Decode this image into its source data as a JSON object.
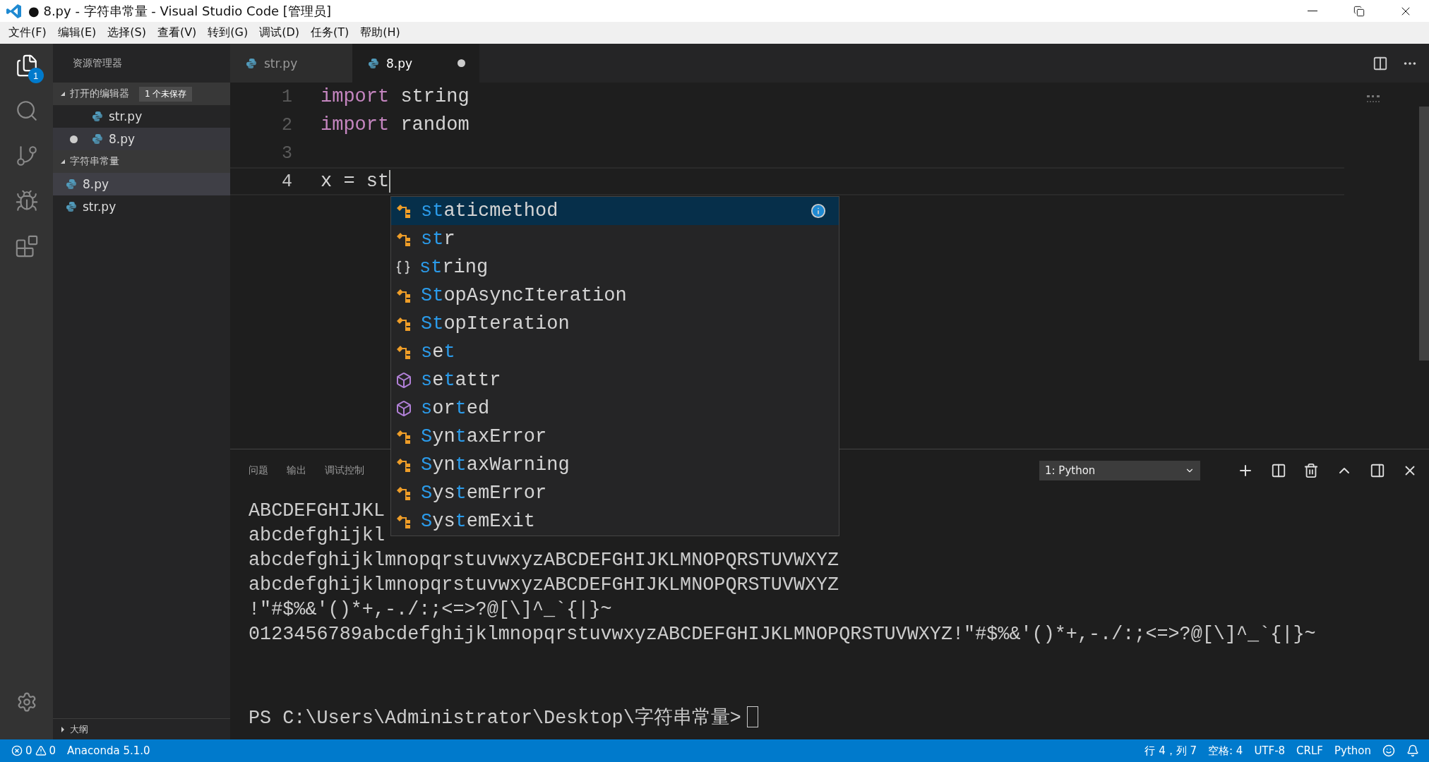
{
  "window": {
    "title": "● 8.py - 字符串常量 - Visual Studio Code [管理员]"
  },
  "menu": [
    "文件(F)",
    "编辑(E)",
    "选择(S)",
    "查看(V)",
    "转到(G)",
    "调试(D)",
    "任务(T)",
    "帮助(H)"
  ],
  "activity_bar": [
    {
      "kind": "explorer",
      "selected": true,
      "badge": "1"
    },
    {
      "kind": "search",
      "selected": false
    },
    {
      "kind": "source-control",
      "selected": false
    },
    {
      "kind": "debug",
      "selected": false
    },
    {
      "kind": "extensions",
      "selected": false
    }
  ],
  "sidebar": {
    "title": "资源管理器",
    "sections": [
      {
        "kind": "open-editors",
        "title": "打开的编辑器",
        "expanded": true,
        "badge": "1 个未保存",
        "items": [
          {
            "label": "str.py",
            "dirty": false,
            "selected": false
          },
          {
            "label": "8.py",
            "dirty": true,
            "selected": true
          }
        ]
      },
      {
        "kind": "folder",
        "title": "字符串常量",
        "expanded": true,
        "items": [
          {
            "label": "8.py",
            "selected": true
          },
          {
            "label": "str.py",
            "selected": false
          }
        ]
      }
    ],
    "outline": {
      "title": "大纲",
      "expanded": false
    }
  },
  "tabs": [
    {
      "label": "str.py",
      "selected": false,
      "dirty": false
    },
    {
      "label": "8.py",
      "selected": true,
      "dirty": true
    }
  ],
  "editor": {
    "lines": [
      {
        "number": "1",
        "current": false,
        "tokens": [
          {
            "kind": "keyword",
            "text": "import"
          },
          {
            "kind": "plain",
            "text": " string"
          }
        ]
      },
      {
        "number": "2",
        "current": false,
        "tokens": [
          {
            "kind": "keyword",
            "text": "import"
          },
          {
            "kind": "plain",
            "text": " random"
          }
        ]
      },
      {
        "number": "3",
        "current": false
      },
      {
        "number": "4",
        "current": true,
        "tokens": [
          {
            "kind": "plain",
            "text": "x = st"
          }
        ]
      }
    ]
  },
  "suggestions": [
    {
      "kind": "class",
      "selected": true,
      "parts": [
        {
          "text": "st",
          "match": true
        },
        {
          "text": "aticmethod",
          "match": false
        }
      ]
    },
    {
      "kind": "class",
      "selected": false,
      "parts": [
        {
          "text": "st",
          "match": true
        },
        {
          "text": "r",
          "match": false
        }
      ]
    },
    {
      "kind": "module",
      "selected": false,
      "parts": [
        {
          "text": "st",
          "match": true
        },
        {
          "text": "ring",
          "match": false
        }
      ]
    },
    {
      "kind": "class",
      "selected": false,
      "parts": [
        {
          "text": "St",
          "match": true
        },
        {
          "text": "opAsyncIteration",
          "match": false
        }
      ]
    },
    {
      "kind": "class",
      "selected": false,
      "parts": [
        {
          "text": "St",
          "match": true
        },
        {
          "text": "opIteration",
          "match": false
        }
      ]
    },
    {
      "kind": "class",
      "selected": false,
      "parts": [
        {
          "text": "s",
          "match": true
        },
        {
          "text": "e",
          "match": false
        },
        {
          "text": "t",
          "match": true
        }
      ]
    },
    {
      "kind": "function",
      "selected": false,
      "parts": [
        {
          "text": "s",
          "match": true
        },
        {
          "text": "e",
          "match": false
        },
        {
          "text": "t",
          "match": true
        },
        {
          "text": "attr",
          "match": false
        }
      ]
    },
    {
      "kind": "function",
      "selected": false,
      "parts": [
        {
          "text": "s",
          "match": true
        },
        {
          "text": "or",
          "match": false
        },
        {
          "text": "t",
          "match": true
        },
        {
          "text": "ed",
          "match": false
        }
      ]
    },
    {
      "kind": "class",
      "selected": false,
      "parts": [
        {
          "text": "S",
          "match": true
        },
        {
          "text": "yn",
          "match": false
        },
        {
          "text": "t",
          "match": true
        },
        {
          "text": "axError",
          "match": false
        }
      ]
    },
    {
      "kind": "class",
      "selected": false,
      "parts": [
        {
          "text": "S",
          "match": true
        },
        {
          "text": "yn",
          "match": false
        },
        {
          "text": "t",
          "match": true
        },
        {
          "text": "axWarning",
          "match": false
        }
      ]
    },
    {
      "kind": "class",
      "selected": false,
      "parts": [
        {
          "text": "S",
          "match": true
        },
        {
          "text": "ys",
          "match": false
        },
        {
          "text": "t",
          "match": true
        },
        {
          "text": "emError",
          "match": false
        }
      ]
    },
    {
      "kind": "class",
      "selected": false,
      "parts": [
        {
          "text": "S",
          "match": true
        },
        {
          "text": "ys",
          "match": false
        },
        {
          "text": "t",
          "match": true
        },
        {
          "text": "emExit",
          "match": false
        }
      ]
    }
  ],
  "panel": {
    "tabs": [
      {
        "label": "问题",
        "selected": false
      },
      {
        "label": "输出",
        "selected": false
      },
      {
        "label": "调试控制",
        "selected": false
      }
    ],
    "terminal_select": "1: Python",
    "lines": [
      "ABCDEFGHIJKL",
      "abcdefghijkl",
      "abcdefghijklmnopqrstuvwxyzABCDEFGHIJKLMNOPQRSTUVWXYZ",
      "abcdefghijklmnopqrstuvwxyzABCDEFGHIJKLMNOPQRSTUVWXYZ",
      "!\"#$%&'()*+,-./:;<=>?@[\\]^_`{|}~",
      "0123456789abcdefghijklmnopqrstuvwxyzABCDEFGHIJKLMNOPQRSTUVWXYZ!\"#$%&'()*+,-./:;<=>?@[\\]^_`{|}~"
    ],
    "prompt": "PS C:\\Users\\Administrator\\Desktop\\字符串常量>"
  },
  "status_bar": {
    "errors": "0",
    "warnings": "0",
    "interpreter": "Anaconda 5.1.0",
    "right": [
      "行 4，列 7",
      "空格: 4",
      "UTF-8",
      "CRLF",
      "Python"
    ]
  }
}
